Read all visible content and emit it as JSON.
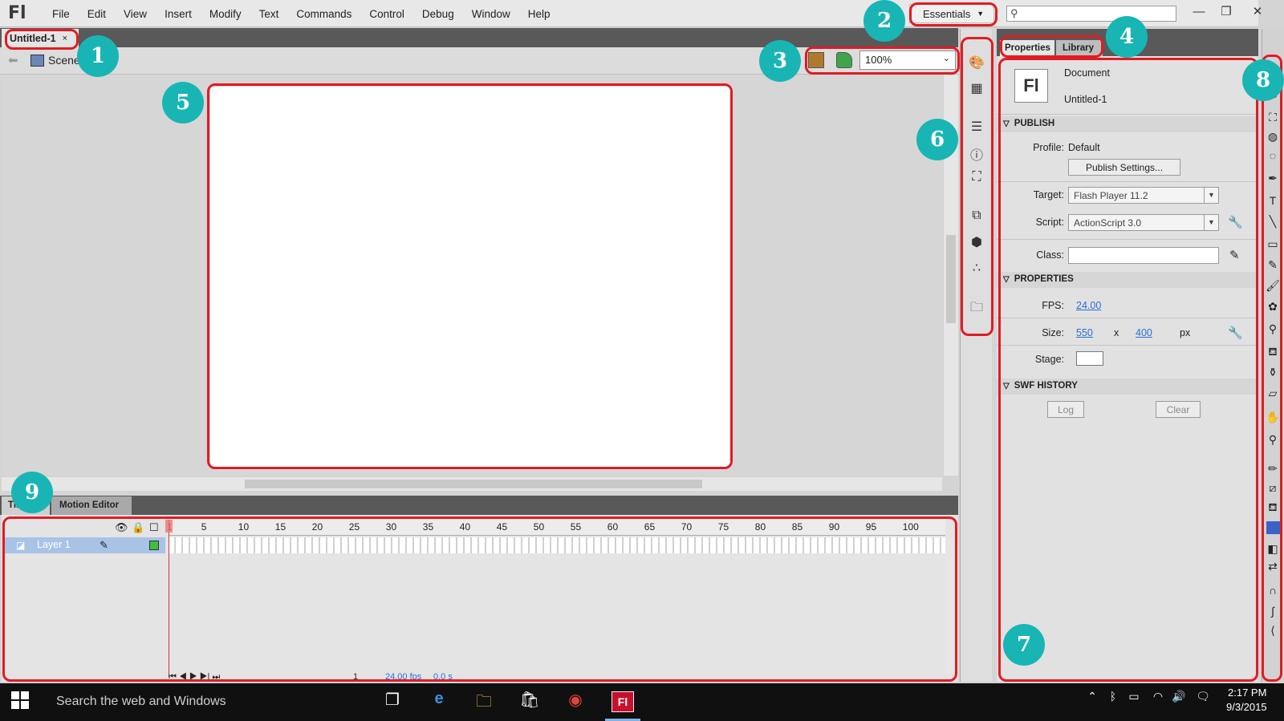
{
  "app": {
    "logo": "Fl",
    "menu": [
      "File",
      "Edit",
      "View",
      "Insert",
      "Modify",
      "Text",
      "Commands",
      "Control",
      "Debug",
      "Window",
      "Help"
    ],
    "workspace": "Essentials",
    "window_controls": {
      "minimize": "—",
      "restore": "❐",
      "close": "✕"
    }
  },
  "document": {
    "tab_name": "Untitled-1",
    "tab_close": "×",
    "scene": "Scene 1",
    "zoom": "100%"
  },
  "timeline": {
    "tabs": [
      "Timeline",
      "Motion Editor"
    ],
    "layer_name": "Layer 1",
    "frame_ticks": [
      "1",
      "5",
      "10",
      "15",
      "20",
      "25",
      "30",
      "35",
      "40",
      "45",
      "50",
      "55",
      "60",
      "65",
      "70",
      "75",
      "80",
      "85",
      "90",
      "95",
      "100"
    ],
    "footer": {
      "current_frame": "1",
      "fps": "24.00 fps",
      "time": "0.0 s"
    }
  },
  "properties": {
    "tabs": [
      "Properties",
      "Library"
    ],
    "doc_type": "Document",
    "doc_name": "Untitled-1",
    "doc_icon_text": "Fl",
    "publish_section": "PUBLISH",
    "profile_label": "Profile:",
    "profile_value": "Default",
    "publish_settings_button": "Publish Settings...",
    "target_label": "Target:",
    "target_value": "Flash Player 11.2",
    "script_label": "Script:",
    "script_value": "ActionScript 3.0",
    "class_label": "Class:",
    "properties_section": "PROPERTIES",
    "fps_label": "FPS:",
    "fps_value": "24.00",
    "size_label": "Size:",
    "width_value": "550",
    "size_x": "x",
    "height_value": "400",
    "size_unit": "px",
    "stage_label": "Stage:",
    "stage_color": "#ffffff",
    "swf_history_section": "SWF HISTORY",
    "log_button": "Log",
    "clear_button": "Clear"
  },
  "taskbar": {
    "search_placeholder": "Search the web and Windows",
    "time": "2:17 PM",
    "date": "9/3/2015"
  },
  "callouts": [
    "1",
    "2",
    "3",
    "4",
    "5",
    "6",
    "7",
    "8",
    "9"
  ],
  "colors": {
    "callout_border": "#e21b23",
    "callout_badge": "#19b5b5",
    "accent": "#2a6ed8"
  }
}
